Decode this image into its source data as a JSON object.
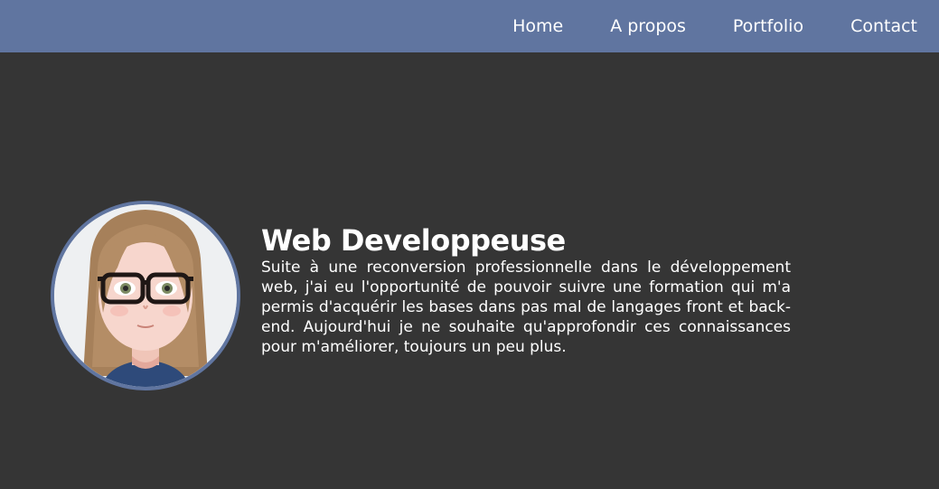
{
  "nav": {
    "items": [
      {
        "label": "Home"
      },
      {
        "label": "A propos"
      },
      {
        "label": "Portfolio"
      },
      {
        "label": "Contact"
      }
    ]
  },
  "hero": {
    "title": "Web Developpeuse",
    "bio": "Suite à une reconversion professionnelle dans le développement web, j'ai eu l'opportunité de pouvoir suivre une formation qui m'a permis d'acquérir les bases dans pas mal de langages front et back-end. Aujourd'hui je ne souhaite qu'approfondir ces connaissances pour m'améliorer, toujours un peu plus."
  },
  "colors": {
    "nav_background": "#6075a0",
    "page_background": "#353535",
    "text": "#ffffff",
    "avatar_border": "#6075a0"
  }
}
